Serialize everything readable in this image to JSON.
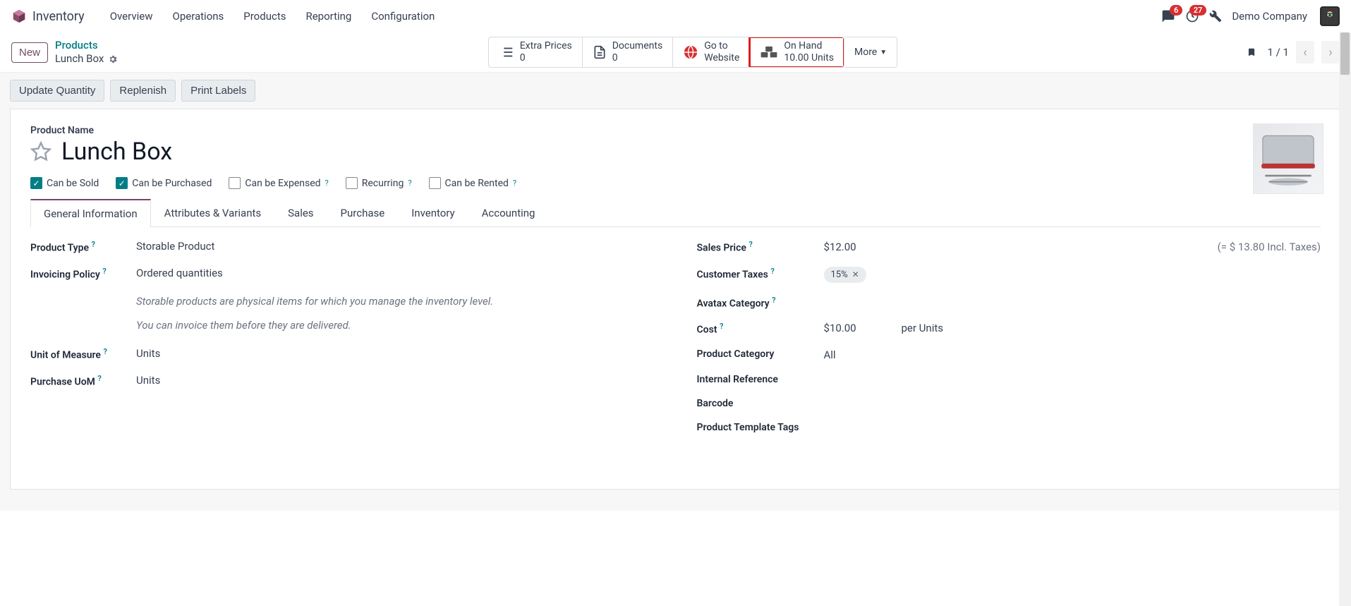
{
  "header": {
    "app_name": "Inventory",
    "menu": [
      "Overview",
      "Operations",
      "Products",
      "Reporting",
      "Configuration"
    ],
    "msg_badge": "6",
    "clock_badge": "27",
    "company": "Demo Company"
  },
  "controlbar": {
    "new_btn": "New",
    "breadcrumb_parent": "Products",
    "breadcrumb_current": "Lunch Box",
    "stats": {
      "extra_prices": {
        "label": "Extra Prices",
        "value": "0"
      },
      "documents": {
        "label": "Documents",
        "value": "0"
      },
      "website": {
        "line1": "Go to",
        "line2": "Website"
      },
      "on_hand": {
        "label": "On Hand",
        "value": "10.00 Units"
      }
    },
    "more": "More",
    "pager": "1 / 1"
  },
  "actions": {
    "update_qty": "Update Quantity",
    "replenish": "Replenish",
    "print_labels": "Print Labels"
  },
  "form": {
    "pname_label": "Product Name",
    "product_name": "Lunch Box",
    "checks": {
      "sold": "Can be Sold",
      "purchased": "Can be Purchased",
      "expensed": "Can be Expensed",
      "recurring": "Recurring",
      "rented": "Can be Rented"
    },
    "tabs": [
      "General Information",
      "Attributes & Variants",
      "Sales",
      "Purchase",
      "Inventory",
      "Accounting"
    ],
    "left": {
      "product_type": {
        "label": "Product Type",
        "value": "Storable Product"
      },
      "invoicing_policy": {
        "label": "Invoicing Policy",
        "value": "Ordered quantities"
      },
      "help1": "Storable products are physical items for which you manage the inventory level.",
      "help2": "You can invoice them before they are delivered.",
      "uom": {
        "label": "Unit of Measure",
        "value": "Units"
      },
      "purchase_uom": {
        "label": "Purchase UoM",
        "value": "Units"
      }
    },
    "right": {
      "sales_price": {
        "label": "Sales Price",
        "value": "$12.00",
        "incl": "(= $ 13.80 Incl. Taxes)"
      },
      "customer_taxes": {
        "label": "Customer Taxes",
        "value": "15%"
      },
      "avatax": {
        "label": "Avatax Category"
      },
      "cost": {
        "label": "Cost",
        "value": "$10.00",
        "per": "per Units"
      },
      "category": {
        "label": "Product Category",
        "value": "All"
      },
      "internal_ref": {
        "label": "Internal Reference"
      },
      "barcode": {
        "label": "Barcode"
      },
      "tags": {
        "label": "Product Template Tags"
      }
    }
  }
}
